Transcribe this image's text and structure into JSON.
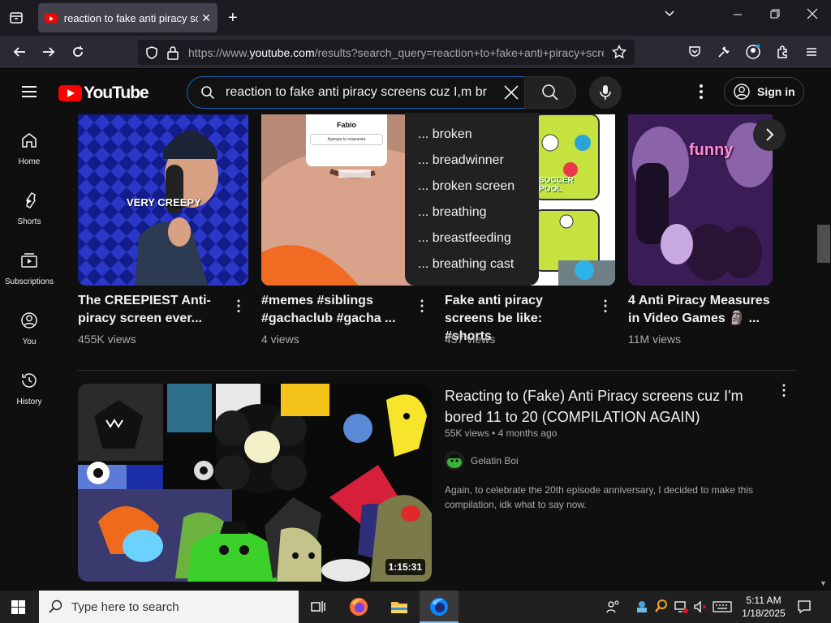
{
  "browser": {
    "tab_title": "reaction to fake anti piracy scre",
    "url_prefix": "https://www.",
    "url_domain": "youtube.com",
    "url_rest": "/results?search_query=reaction+to+fake+anti+piracy+scre"
  },
  "youtube": {
    "logo_text": "YouTube",
    "search_query": "reaction to fake anti piracy screens cuz I,m br",
    "sign_in_label": "Sign in"
  },
  "guide": {
    "items": [
      {
        "label": "Home",
        "icon": "home-icon"
      },
      {
        "label": "Shorts",
        "icon": "shorts-icon"
      },
      {
        "label": "Subscriptions",
        "icon": "subscriptions-icon"
      },
      {
        "label": "You",
        "icon": "account-icon"
      },
      {
        "label": "History",
        "icon": "history-icon"
      }
    ]
  },
  "suggestions": [
    "... broken",
    "... breadwinner",
    "... broken screen",
    "... breathing",
    "... breastfeeding",
    "... breathing cast"
  ],
  "shorts": [
    {
      "title": "The CREEPIEST Anti-piracy screen ever...",
      "views": "455K views",
      "overlay": "VERY CREEPY"
    },
    {
      "title": "#memes #siblings #gachaclub #gacha ...",
      "views": "4 views",
      "overlay_name": "Fabio",
      "overlay_btn": "Agregar tu respuesta"
    },
    {
      "title": "Fake anti piracy screens be like: #shorts",
      "views": "457 views",
      "overlay": "SOCCER POOL"
    },
    {
      "title": "4 Anti Piracy Measures in Video Games 🗿 ...",
      "views": "11M views",
      "overlay": "funny"
    }
  ],
  "video": {
    "title": "Reacting to (Fake) Anti Piracy screens cuz I'm bored 11 to 20 (COMPILATION AGAIN)",
    "views": "55K views",
    "age": "4 months ago",
    "meta_sep": "•",
    "channel": "Gelatin Boi",
    "description": "Again, to celebrate the 20th episode anniversary, I decided to make this compilation, idk what to say now.",
    "duration": "1:15:31"
  },
  "taskbar": {
    "search_placeholder": "Type here to search",
    "time": "5:11 AM",
    "date": "1/18/2025"
  },
  "colors": {
    "yt_red": "#ff0000",
    "search_border": "#1c62b9",
    "background": "#0f0f0f"
  }
}
